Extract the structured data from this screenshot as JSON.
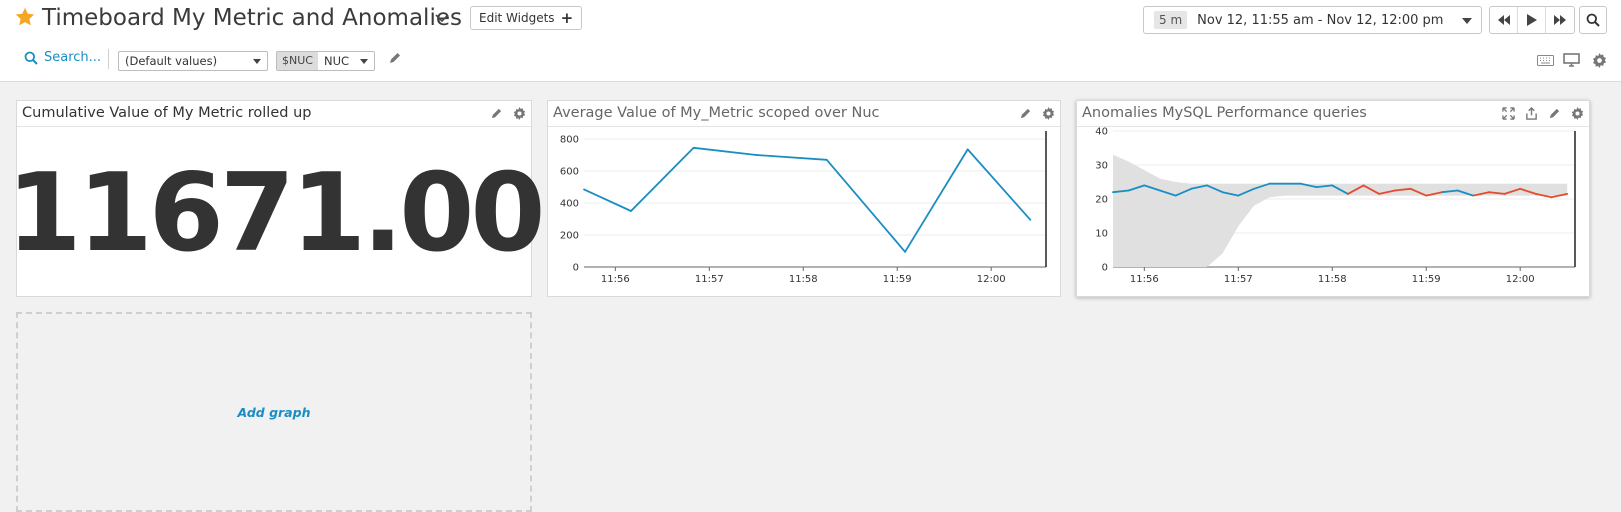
{
  "header": {
    "title": "Timeboard My Metric and Anomalies",
    "edit_widgets_label": "Edit Widgets",
    "star_color": "#f5a623",
    "timepicker": {
      "span": "5 m",
      "range": "Nov 12, 11:55 am - Nov 12, 12:00 pm"
    },
    "icons": {
      "star": "star-icon",
      "chevron": "chevron-down-icon",
      "prev": "rewind-icon",
      "play": "play-icon",
      "next": "fast-forward-icon",
      "zoom": "search-icon",
      "keyboard": "keyboard-icon",
      "tv": "tv-mode-icon",
      "settings": "gear-icon"
    }
  },
  "toolbar": {
    "search_label": "Search...",
    "default_values": "(Default values)",
    "template_var_tag": "$NUC",
    "template_var_value": "NUC"
  },
  "widgets": [
    {
      "title": "Cumulative Value of My Metric rolled up",
      "value": "11671.00"
    },
    {
      "title": "Average Value of My_Metric scoped over Nuc"
    },
    {
      "title": "Anomalies MySQL Performance queries"
    }
  ],
  "add_graph_label": "Add graph",
  "accent_color": "#1a8ec2",
  "chart_data": [
    {
      "type": "line",
      "title": "Average Value of My_Metric scoped over Nuc",
      "x_ticks": [
        "11:56",
        "11:57",
        "11:58",
        "11:59",
        "12:00"
      ],
      "ylim": [
        0,
        850
      ],
      "y_ticks": [
        0,
        200,
        400,
        600,
        800
      ],
      "grid": true,
      "series": [
        {
          "color": "#1a8ec2",
          "x": [
            "11:55:40",
            "11:56:10",
            "11:56:50",
            "11:57:30",
            "11:58:15",
            "11:59:05",
            "11:59:45",
            "12:00:25"
          ],
          "values": [
            485,
            350,
            745,
            700,
            670,
            95,
            735,
            295
          ]
        }
      ]
    },
    {
      "type": "line",
      "title": "Anomalies MySQL Performance queries",
      "x_ticks": [
        "11:56",
        "11:57",
        "11:58",
        "11:59",
        "12:00"
      ],
      "ylim": [
        0,
        40
      ],
      "y_ticks": [
        0,
        10,
        20,
        30,
        40
      ],
      "grid": true,
      "series": [
        {
          "color": "#1a8ec2",
          "anomaly_color": "#e54b2e",
          "x": [
            "11:55:40",
            "11:55:50",
            "11:56:00",
            "11:56:10",
            "11:56:20",
            "11:56:30",
            "11:56:40",
            "11:56:50",
            "11:57:00",
            "11:57:10",
            "11:57:20",
            "11:57:30",
            "11:57:40",
            "11:57:50",
            "11:58:00",
            "11:58:10",
            "11:58:20",
            "11:58:30",
            "11:58:40",
            "11:58:50",
            "11:59:00",
            "11:59:10",
            "11:59:20",
            "11:59:30",
            "11:59:40",
            "11:59:50",
            "12:00:00",
            "12:00:10",
            "12:00:20",
            "12:00:30"
          ],
          "values": [
            22,
            22.5,
            24,
            22.5,
            21,
            23,
            24,
            22,
            21,
            23,
            24.5,
            24.5,
            24.5,
            23.5,
            24,
            21.5,
            24,
            21.5,
            22.5,
            23,
            21,
            22,
            22.5,
            21,
            22,
            21.5,
            23,
            21.5,
            20.5,
            21.5
          ],
          "anomalies": [
            15,
            16,
            17,
            18,
            19,
            20,
            21,
            23,
            24,
            25,
            26,
            27,
            28,
            29
          ]
        }
      ],
      "band": {
        "color": "#e0e0e0",
        "x": [
          "11:55:40",
          "11:55:50",
          "11:56:00",
          "11:56:10",
          "11:56:20",
          "11:56:30",
          "11:56:40",
          "11:56:50",
          "11:57:00",
          "11:57:10",
          "11:57:20",
          "11:57:30",
          "11:57:40",
          "11:57:50",
          "11:58:00",
          "11:58:10",
          "11:58:20",
          "11:58:30",
          "11:58:40",
          "11:58:50",
          "11:59:00",
          "11:59:10",
          "11:59:20",
          "11:59:30",
          "11:59:40",
          "11:59:50",
          "12:00:00",
          "12:00:10",
          "12:00:20",
          "12:00:30"
        ],
        "upper": [
          33,
          31,
          28.5,
          26,
          25,
          24.5,
          24.5,
          24.5,
          24.5,
          24.5,
          24.5,
          24.5,
          24.5,
          24.5,
          24.5,
          24.5,
          24.5,
          24.5,
          24.5,
          24.5,
          24.5,
          24.5,
          24.5,
          24.5,
          24.5,
          24.5,
          24.5,
          24.5,
          24.5,
          24.5
        ],
        "lower": [
          0,
          0,
          0,
          0,
          0,
          0,
          0,
          4,
          12,
          18,
          20.5,
          21,
          21,
          21,
          21,
          21,
          21,
          21,
          21,
          21,
          21,
          21,
          21,
          21,
          21,
          21,
          21,
          21,
          21,
          21
        ]
      }
    }
  ]
}
